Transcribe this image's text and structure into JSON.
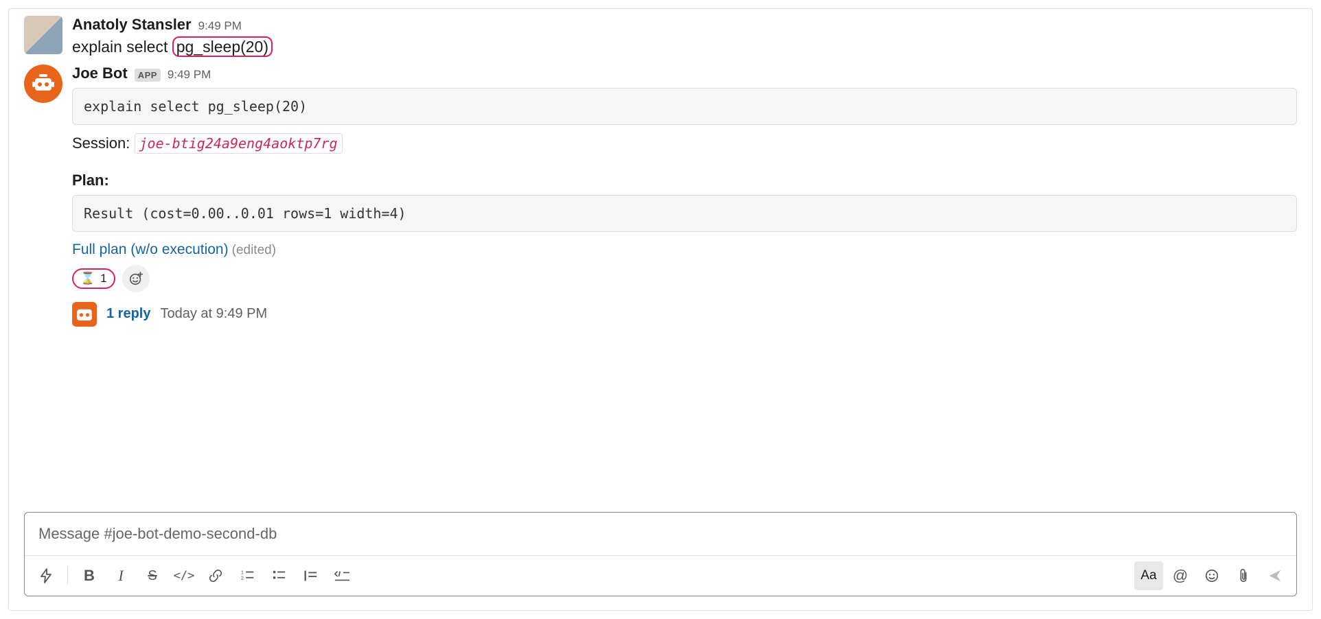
{
  "messages": [
    {
      "author": "Anatoly Stansler",
      "time": "9:49 PM",
      "text_prefix": "explain select",
      "text_highlight": "pg_sleep(20)"
    },
    {
      "author": "Joe Bot",
      "app_badge": "APP",
      "time": "9:49 PM",
      "codeblock1": "explain select pg_sleep(20)",
      "session_label": "Session:",
      "session_id": "joe-btig24a9eng4aoktp7rg",
      "plan_heading": "Plan:",
      "codeblock2": "Result  (cost=0.00..0.01 rows=1 width=4)",
      "link_text": "Full plan (w/o execution)",
      "edited_label": "(edited)",
      "reaction_emoji": "⌛",
      "reaction_count": "1",
      "thread_reply_text": "1 reply",
      "thread_time": "Today at 9:49 PM"
    }
  ],
  "composer": {
    "placeholder": "Message #joe-bot-demo-second-db"
  },
  "toolbar": {
    "shortcut": "Shortcuts",
    "bold": "B",
    "italic": "I",
    "strike": "S",
    "code": "</>",
    "link": "Link",
    "olist": "Numbered",
    "ulist": "Bulleted",
    "quote": "Quote",
    "codeblock": "Code block",
    "aa": "Aa",
    "at": "@",
    "emoji": "Emoji",
    "attach": "Attach",
    "send": "Send"
  }
}
